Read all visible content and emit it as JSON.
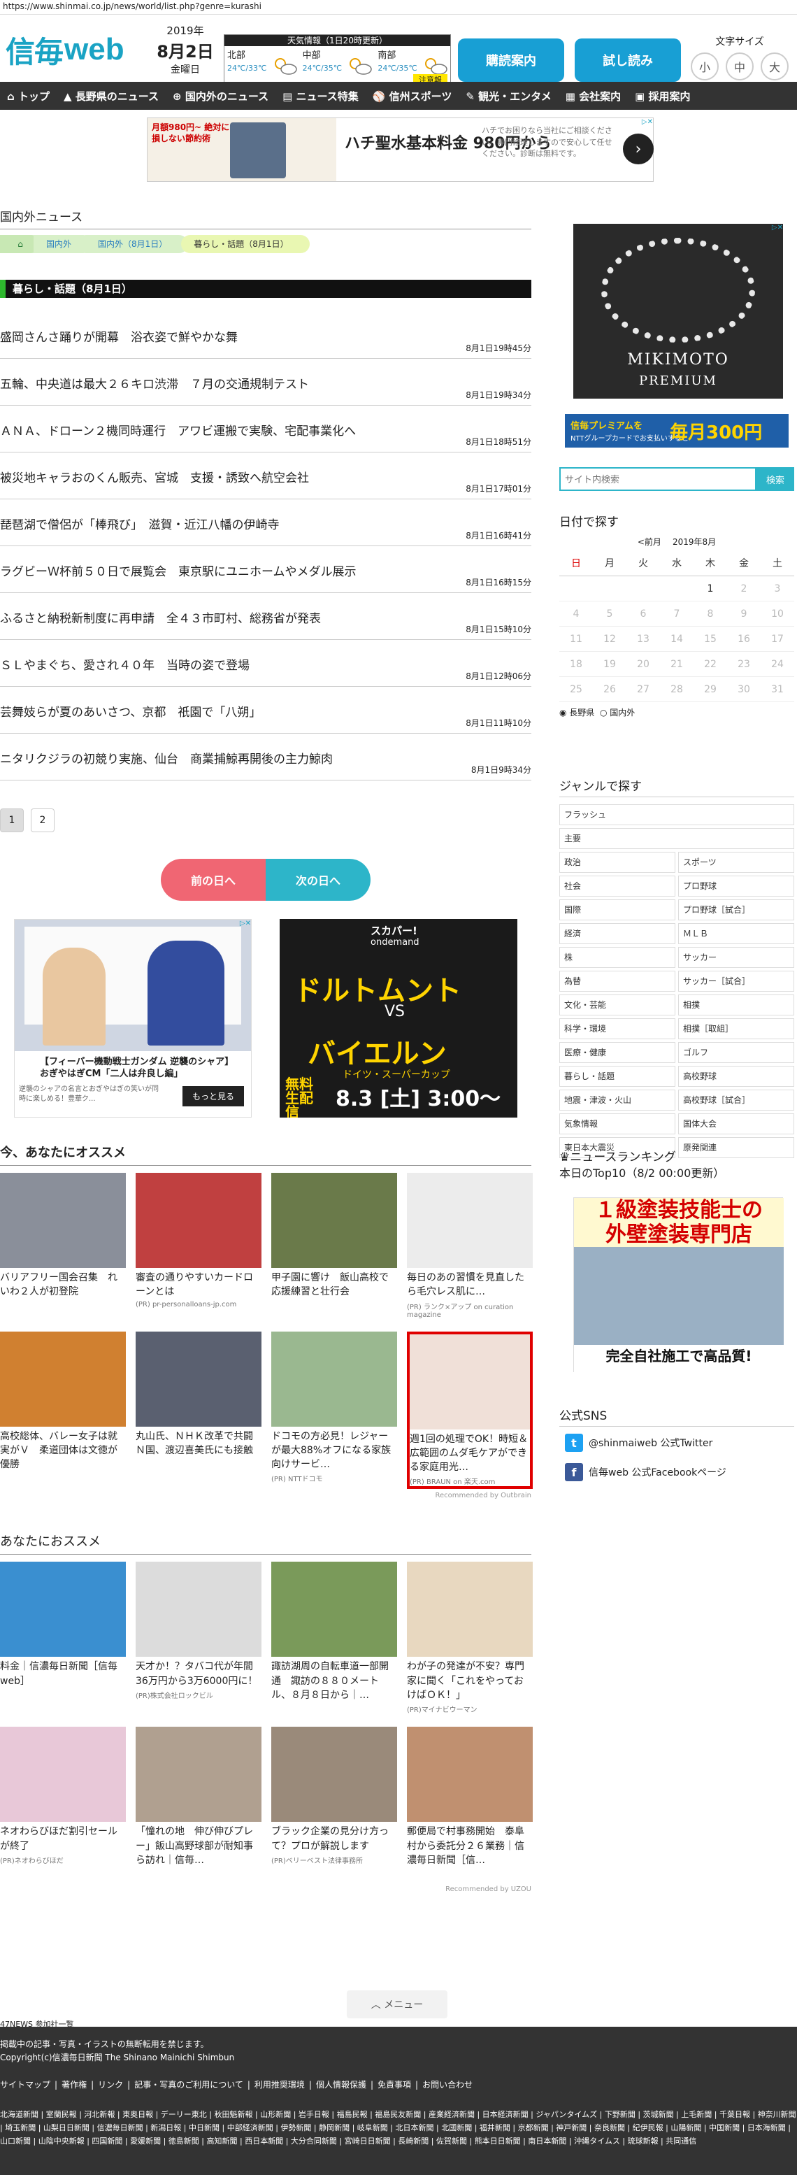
{
  "url": "https://www.shinmai.co.jp/news/world/list.php?genre=kurashi",
  "header": {
    "logo_kanji": "信毎",
    "logo_web": "web",
    "year": "2019年",
    "month_day": "8月2日",
    "weekday": "金曜日",
    "weather_title": "天気情報（1日20時更新）",
    "regions": [
      {
        "name": "北部",
        "temp": "24℃/33℃"
      },
      {
        "name": "中部",
        "temp": "24℃/35℃"
      },
      {
        "name": "南部",
        "temp": "24℃/35℃"
      }
    ],
    "weather_note": "注意報",
    "btn_subscribe": "購読案内",
    "btn_trial": "試し読み",
    "fontsize_label": "文字サイズ",
    "fontsize_options": [
      "小",
      "中",
      "大"
    ]
  },
  "nav": [
    "トップ",
    "長野県のニュース",
    "国内外のニュース",
    "ニュース特集",
    "信州スポーツ",
    "観光・エンタメ",
    "会社案内",
    "採用案内"
  ],
  "ad_top": {
    "text_left": "月額980円~ 絶対に損しない節約術",
    "headline": "ハチ聖水基本料金 980円から",
    "sub": "ハチでお困りなら当社にご相談ください。専門修理しますので安心して任せください。診断は無料です。"
  },
  "main": {
    "section_title": "国内外ニュース",
    "breadcrumb": [
      "国内外",
      "国内外（8月1日）",
      "暮らし・話題（8月1日）"
    ],
    "genre_heading": "暮らし・話題（8月1日）",
    "news": [
      {
        "title": "盛岡さんさ踊りが開幕　浴衣姿で鮮やかな舞",
        "time": "8月1日19時45分"
      },
      {
        "title": "五輪、中央道は最大２６キロ渋滞　７月の交通規制テスト",
        "time": "8月1日19時34分"
      },
      {
        "title": "ＡＮＡ、ドローン２機同時運行　アワビ運搬で実験、宅配事業化へ",
        "time": "8月1日18時51分"
      },
      {
        "title": "被災地キャラおのくん販売、宮城　支援・誘致へ航空会社",
        "time": "8月1日17時01分"
      },
      {
        "title": "琵琶湖で僧侶が「棒飛び」　滋賀・近江八幡の伊崎寺",
        "time": "8月1日16時41分"
      },
      {
        "title": "ラグビーＷ杯前５０日で展覧会　東京駅にユニホームやメダル展示",
        "time": "8月1日16時15分"
      },
      {
        "title": "ふるさと納税新制度に再申請　全４３市町村、総務省が発表",
        "time": "8月1日15時10分"
      },
      {
        "title": "ＳＬやまぐち、愛され４０年　当時の姿で登場",
        "time": "8月1日12時06分"
      },
      {
        "title": "芸舞妓らが夏のあいさつ、京都　祇園で「八朔」",
        "time": "8月1日11時10分"
      },
      {
        "title": "ニタリクジラの初競り実施、仙台　商業捕鯨再開後の主力鯨肉",
        "time": "8月1日9時34分"
      }
    ],
    "pages": [
      "1",
      "2"
    ],
    "prev_day": "前の日へ",
    "next_day": "次の日へ"
  },
  "ads_mid": {
    "left_caption": "【フィーバー機動戦士ガンダム 逆襲のシャア】おぎやはぎCM「二人は弁良し編」",
    "left_sub": "逆襲のシャアの名言とおぎやはぎの笑いが同時に楽しめる！豊華ク...",
    "left_button": "もっと見る",
    "right_top1": "スカパー!",
    "right_top2": "ondemand",
    "right_t1": "ドルトムント",
    "right_vs": "VS",
    "right_t2": "バイエルン",
    "right_cup": "ドイツ・スーパーカップ",
    "right_date": "8.3 [土] 3:00～",
    "right_free": "無料生配信"
  },
  "rec1": {
    "title": "今、あなたにオススメ",
    "cards": [
      {
        "title": "バリアフリー国会召集　れいわ２人が初登院",
        "src": "",
        "color": "#8a8f9a"
      },
      {
        "title": "審査の通りやすいカードローンとは",
        "src": "(PR) pr-personalloans-jp.com",
        "color": "#c04040"
      },
      {
        "title": "甲子園に響け　飯山高校で応援練習と壮行会",
        "src": "",
        "color": "#6a7a4a"
      },
      {
        "title": "毎日のあの習慣を見直したら毛穴レス肌に…",
        "src": "(PR) ランク×アップ on curation magazine",
        "color": "#ececec"
      },
      {
        "title": "高校総体、バレー女子は就実がＶ　柔道団体は文徳が優勝",
        "src": "",
        "color": "#d08030"
      },
      {
        "title": "丸山氏、ＮＨＫ改革で共闘　Ｎ国、渡辺喜美氏にも接触",
        "src": "",
        "color": "#5a6070"
      },
      {
        "title": "ドコモの方必見！レジャーが最大88%オフになる家族向けサービ…",
        "src": "(PR) NTTドコモ",
        "color": "#9ab890"
      },
      {
        "title": "週1回の処理でOK！時短＆広範囲のムダ毛ケアができる家庭用光…",
        "src": "(PR) BRAUN on 楽天.com",
        "color": "#f0e0d8"
      }
    ],
    "outbrain": "Recommended by Outbrain"
  },
  "rec2": {
    "title": "あなたにおススメ",
    "cards": [
      {
        "title": "料金｜信濃毎日新聞［信毎web］",
        "src": "",
        "color": "#3a8fd0"
      },
      {
        "title": "天才か！？タバコ代が年間36万円から3万6000円に！",
        "src": "(PR)株式会社ロックビル",
        "color": "#dcdcdc"
      },
      {
        "title": "諏訪湖周の自転車道一部開通　諏訪の８８０メートル、８月８日から｜…",
        "src": "",
        "color": "#7a9a5a"
      },
      {
        "title": "わが子の発達が不安？専門家に聞く「これをやっておけばＯＫ！」",
        "src": "(PR)マイナビウーマン",
        "color": "#e8d8c0"
      },
      {
        "title": "ネオわらびほだ割引セールが終了",
        "src": "(PR)ネオわらびほだ",
        "color": "#e8c8d8"
      },
      {
        "title": "「憧れの地　伸び伸びプレー」飯山高野球部が耐知事ら訪れ｜信毎…",
        "src": "",
        "color": "#b0a090"
      },
      {
        "title": "ブラック企業の見分け方って？プロが解説します",
        "src": "(PR)ベリーベスト法律事務所",
        "color": "#9a8a7a"
      },
      {
        "title": "郵便局で村事務開始　泰阜　村から委託分２６業務｜信濃毎日新聞［信…",
        "src": "",
        "color": "#c09070"
      }
    ],
    "recommended": "Recommended by UZOU"
  },
  "menu_label": "メニュー",
  "sidebar": {
    "ad_brand": "MIKIMOTO",
    "ad_brand2": "PREMIUM",
    "ad2_t1": "信毎プレミアムを",
    "ad2_t2": "NTTグループカードでお支払いすると",
    "ad2_t3": "毎月300円",
    "search_placeholder": "サイト内検索",
    "search_button": "検索",
    "date_title": "日付で探す",
    "cal_prev": "<前月",
    "cal_month": "2019年8月",
    "weekdays": [
      "日",
      "月",
      "火",
      "水",
      "木",
      "金",
      "土"
    ],
    "weeks": [
      [
        "",
        "",
        "",
        "",
        "1",
        "2",
        "3"
      ],
      [
        "4",
        "5",
        "6",
        "7",
        "8",
        "9",
        "10"
      ],
      [
        "11",
        "12",
        "13",
        "14",
        "15",
        "16",
        "17"
      ],
      [
        "18",
        "19",
        "20",
        "21",
        "22",
        "23",
        "24"
      ],
      [
        "25",
        "26",
        "27",
        "28",
        "29",
        "30",
        "31"
      ]
    ],
    "cal_opt1": "長野県",
    "cal_opt2": "国内外",
    "genre_title": "ジャンルで探す",
    "genres_full": [
      "フラッシュ",
      "主要"
    ],
    "genres": [
      "政治",
      "スポーツ",
      "社会",
      "プロ野球",
      "国際",
      "プロ野球［試合］",
      "経済",
      "ＭＬＢ",
      "株",
      "サッカー",
      "為替",
      "サッカー［試合］",
      "文化・芸能",
      "相撲",
      "科学・環境",
      "相撲［取組］",
      "医療・健康",
      "ゴルフ",
      "暮らし・話題",
      "高校野球",
      "地震・津波・火山",
      "高校野球［試合］",
      "気象情報",
      "国体大会",
      "東日本大震災",
      "原発関連"
    ],
    "ranking_title": "ニュースランキング",
    "ranking_sub": "本日のTop10（8/2 00:00更新）",
    "ad3_t1": "１級塗装技能士の",
    "ad3_t2": "外壁塗装専門店",
    "ad3_t3": "完全自社施工で高品質!",
    "sns_title": "公式SNS",
    "twitter": "@shinmaiweb 公式Twitter",
    "facebook": "信毎web 公式Facebookページ"
  },
  "footer": {
    "p47": "47NEWS 参加社一覧",
    "notice": "掲載中の記事・写真・イラストの無断転用を禁じます。",
    "copyright": "Copyright(c)信濃毎日新聞 The Shinano Mainichi Shimbun",
    "links": [
      "サイトマップ",
      "著作権",
      "リンク",
      "記事・写真のご利用について",
      "利用推奨環境",
      "個人情報保護",
      "免責事項",
      "お問い合わせ"
    ],
    "papers": "北海道新聞 | 室蘭民報 | 河北新報 | 東奥日報 | デーリー東北 | 秋田魁新報 | 山形新聞 | 岩手日報 | 福島民報 | 福島民友新聞 | 産業経済新聞 | 日本経済新聞 | ジャパンタイムズ | 下野新聞 | 茨城新聞 | 上毛新聞 | 千葉日報 | 神奈川新聞 | 埼玉新聞 | 山梨日日新聞 | 信濃毎日新聞 | 新潟日報 | 中日新聞 | 中部経済新聞 | 伊勢新聞 | 静岡新聞 | 岐阜新聞 | 北日本新聞 | 北國新聞 | 福井新聞 | 京都新聞 | 神戸新聞 | 奈良新聞 | 紀伊民報 | 山陽新聞 | 中国新聞 | 日本海新聞 | 山口新聞 | 山陰中央新報 | 四国新聞 | 愛媛新聞 | 徳島新聞 | 高知新聞 | 西日本新聞 | 大分合同新聞 | 宮崎日日新聞 | 長崎新聞 | 佐賀新聞 | 熊本日日新聞 | 南日本新聞 | 沖縄タイムス | 琉球新報 | 共同通信"
  }
}
